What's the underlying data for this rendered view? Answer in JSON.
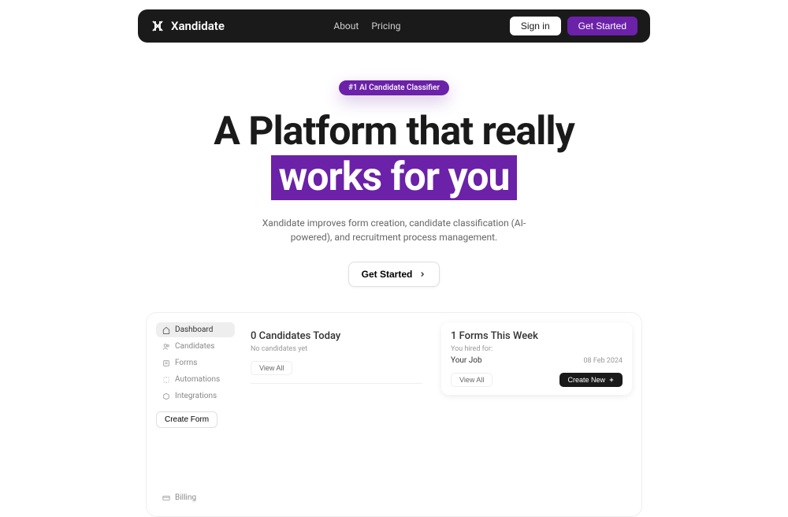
{
  "nav": {
    "brand": "Xandidate",
    "links": {
      "about": "About",
      "pricing": "Pricing"
    },
    "signin": "Sign in",
    "getstarted": "Get Started"
  },
  "hero": {
    "badge": "#1 AI Candidate Classifier",
    "title_line1": "A Platform that really",
    "title_highlight": "works for you",
    "subtitle": "Xandidate improves form creation, candidate classification (AI-powered), and recruitment process management.",
    "cta": "Get Started"
  },
  "sidebar": {
    "dashboard": "Dashboard",
    "candidates": "Candidates",
    "forms": "Forms",
    "automations": "Automations",
    "integrations": "Integrations",
    "createform": "Create Form",
    "billing": "Billing"
  },
  "cards": {
    "candidates": {
      "title": "0 Candidates Today",
      "sub": "No candidates yet",
      "viewall": "View All"
    },
    "forms": {
      "title": "1 Forms This Week",
      "sub": "You hired for:",
      "job": "Your Job",
      "date": "08 Feb 2024",
      "viewall": "View All",
      "createnew": "Create New"
    }
  }
}
